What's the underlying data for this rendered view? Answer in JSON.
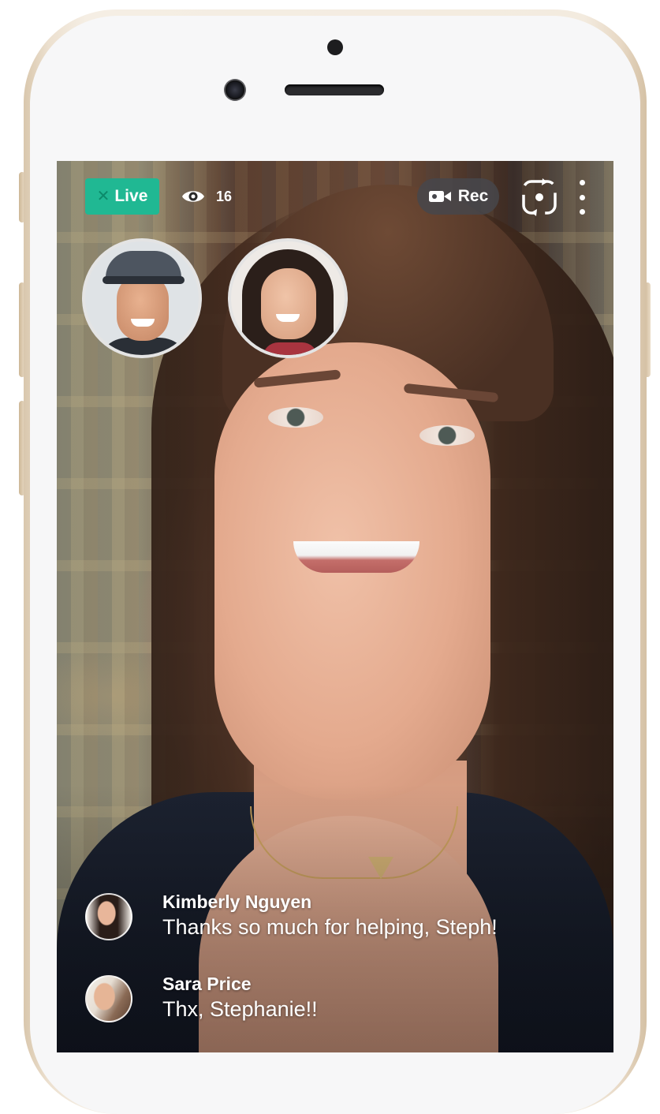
{
  "app": {
    "live_label": "Live",
    "live_close_glyph": "✕",
    "viewer_count": "16",
    "viewer_icon": "eye-icon",
    "rec_label": "Rec",
    "rec_icon": "camcorder-icon",
    "flip_icon": "flip-camera-icon",
    "menu_icon": "more-vertical-icon"
  },
  "colors": {
    "live_badge": "#20b893",
    "rec_pill": "#46464b",
    "phone_frame": "#f3ebdf"
  },
  "guests": [
    {
      "name": "guest-1"
    },
    {
      "name": "guest-2"
    }
  ],
  "comments": [
    {
      "name": "Kimberly Nguyen",
      "text": "Thanks so much for helping, Steph!"
    },
    {
      "name": "Sara Price",
      "text": "Thx, Stephanie!!"
    }
  ]
}
